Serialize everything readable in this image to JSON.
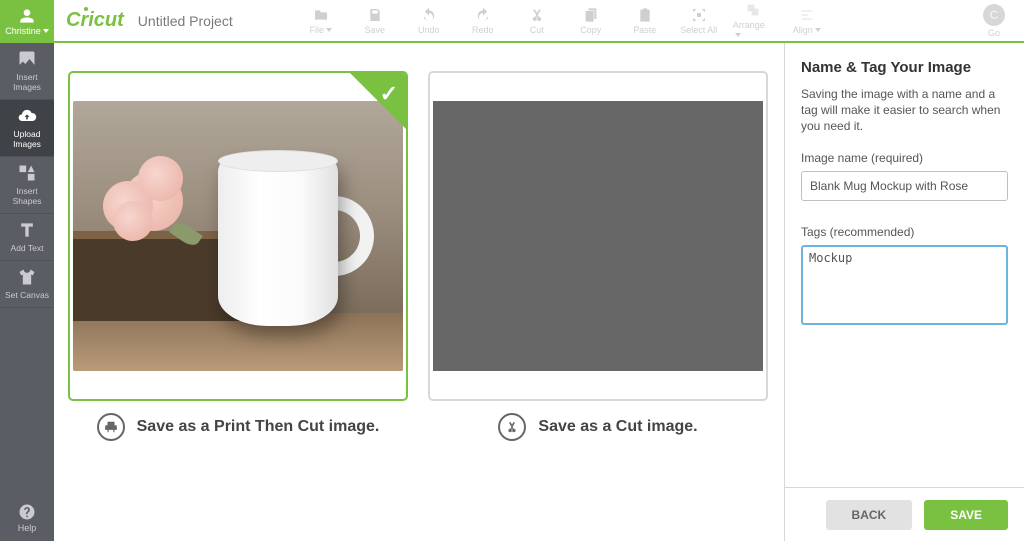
{
  "user": {
    "name": "Christine"
  },
  "brand": "Cricut",
  "project_name": "Untitled Project",
  "sidebar": {
    "items": [
      {
        "label": "Insert\nImages"
      },
      {
        "label": "Upload\nImages"
      },
      {
        "label": "Insert\nShapes"
      },
      {
        "label": "Add Text"
      },
      {
        "label": "Set Canvas"
      }
    ],
    "help": "Help"
  },
  "toolbar": {
    "file": "File",
    "save": "Save",
    "undo": "Undo",
    "redo": "Redo",
    "cut": "Cut",
    "copy": "Copy",
    "paste": "Paste",
    "select_all": "Select All",
    "arrange": "Arrange",
    "align": "Align",
    "go": "Go"
  },
  "cards": {
    "print_then_cut": "Save as a Print Then Cut image.",
    "cut_image": "Save as a Cut image."
  },
  "panel": {
    "title": "Name & Tag Your Image",
    "hint": "Saving the image with a name and a tag will make it easier to search when you need it.",
    "name_label": "Image name (required)",
    "name_value": "Blank Mug Mockup with Rose",
    "tags_label": "Tags (recommended)",
    "tags_value": "Mockup",
    "back": "BACK",
    "save": "SAVE"
  }
}
